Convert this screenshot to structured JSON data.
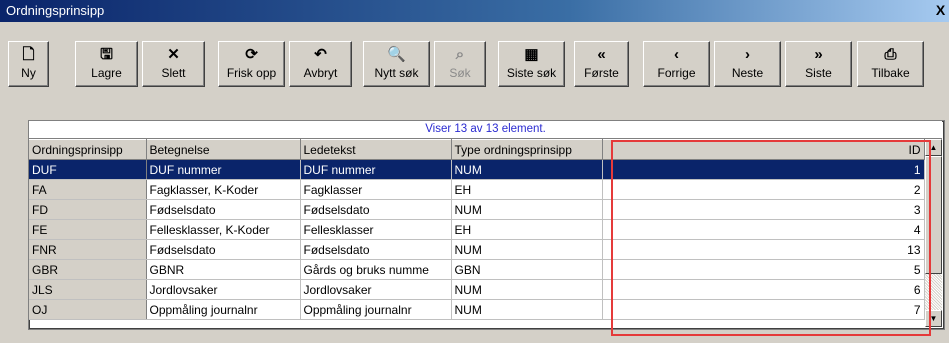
{
  "window": {
    "title": "Ordningsprinsipp",
    "close_label": "X"
  },
  "toolbar": [
    {
      "name": "new-button",
      "icon": "new-doc-icon",
      "label": "Ny",
      "disabled": false
    },
    {
      "name": "save-button",
      "icon": "floppy-icon",
      "label": "Lagre",
      "disabled": false
    },
    {
      "name": "delete-button",
      "icon": "x-icon",
      "label": "Slett",
      "disabled": false
    },
    {
      "name": "refresh-button",
      "icon": "refresh-icon",
      "label": "Frisk opp",
      "disabled": false
    },
    {
      "name": "cancel-button",
      "icon": "undo-icon",
      "label": "Avbryt",
      "disabled": false
    },
    {
      "name": "new-search-button",
      "icon": "magnifier-icon",
      "label": "Nytt søk",
      "disabled": false
    },
    {
      "name": "search-button",
      "icon": "binoculars-icon",
      "label": "Søk",
      "disabled": true
    },
    {
      "name": "last-search-button",
      "icon": "grid-icon",
      "label": "Siste søk",
      "disabled": false
    },
    {
      "name": "first-button",
      "icon": "double-left-icon",
      "label": "Første",
      "disabled": false
    },
    {
      "name": "previous-button",
      "icon": "left-icon",
      "label": "Forrige",
      "disabled": false
    },
    {
      "name": "next-button",
      "icon": "right-icon",
      "label": "Neste",
      "disabled": false
    },
    {
      "name": "last-button",
      "icon": "double-right-icon",
      "label": "Siste",
      "disabled": false
    },
    {
      "name": "back-button",
      "icon": "printer-back-icon",
      "label": "Tilbake",
      "disabled": false
    }
  ],
  "grid": {
    "status": "Viser 13 av 13 element.",
    "columns": [
      "Ordningsprinsipp",
      "Betegnelse",
      "Ledetekst",
      "Type ordningsprinsipp",
      "ID"
    ],
    "selected_row": 0,
    "rows": [
      [
        "DUF",
        "DUF nummer",
        "DUF nummer",
        "NUM",
        "1"
      ],
      [
        "FA",
        "Fagklasser, K-Koder",
        "Fagklasser",
        "EH",
        "2"
      ],
      [
        "FD",
        "Fødselsdato",
        "Fødselsdato",
        "NUM",
        "3"
      ],
      [
        "FE",
        "Fellesklasser, K-Koder",
        "Fellesklasser",
        "EH",
        "4"
      ],
      [
        "FNR",
        "Fødselsdato",
        "Fødselsdato",
        "NUM",
        "13"
      ],
      [
        "GBR",
        "GBNR",
        "Gårds og bruks numme",
        "GBN",
        "5"
      ],
      [
        "JLS",
        "Jordlovsaker",
        "Jordlovsaker",
        "NUM",
        "6"
      ],
      [
        "OJ",
        "Oppmåling journalnr",
        "Oppmåling journalnr",
        "NUM",
        "7"
      ]
    ]
  },
  "colors": {
    "selection": "#0a246a",
    "highlight": "#e53a3a",
    "status_text": "#2b2bd1"
  }
}
